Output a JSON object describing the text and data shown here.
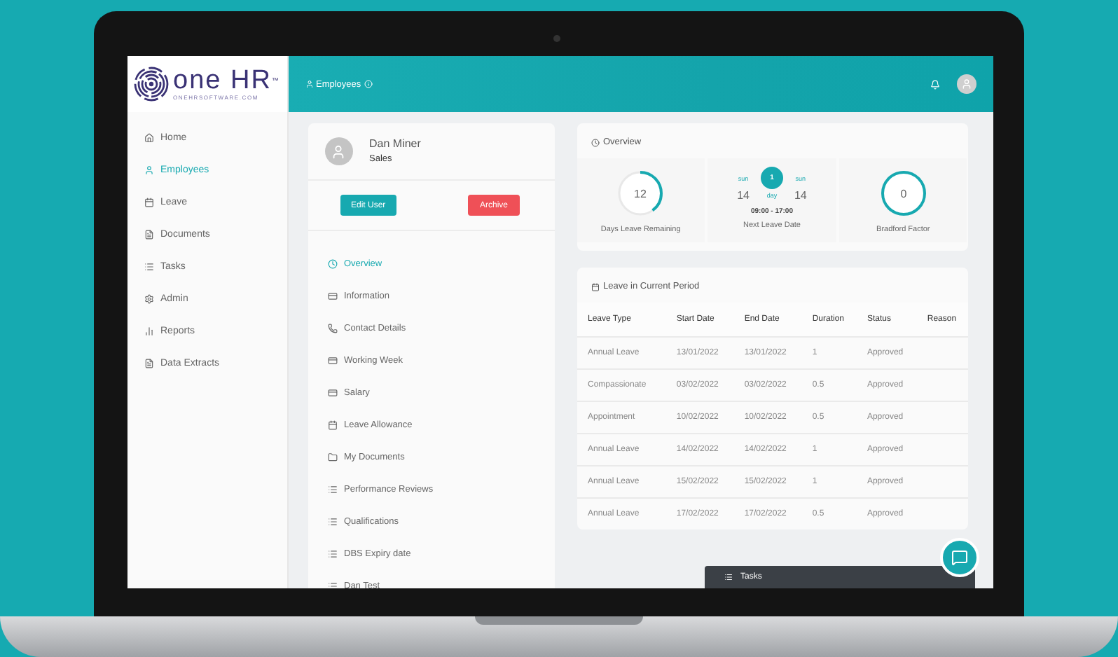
{
  "logo": {
    "name": "one HR",
    "trademark": "™",
    "tagline": "ONEHRSOFTWARE.COM"
  },
  "sidebar": {
    "items": [
      {
        "label": "Home",
        "kind": "home",
        "selected": false
      },
      {
        "label": "Employees",
        "kind": "user",
        "selected": true
      },
      {
        "label": "Leave",
        "kind": "calendar",
        "selected": false
      },
      {
        "label": "Documents",
        "kind": "file",
        "selected": false
      },
      {
        "label": "Tasks",
        "kind": "list",
        "selected": false
      },
      {
        "label": "Admin",
        "kind": "gear",
        "selected": false
      },
      {
        "label": "Reports",
        "kind": "chart",
        "selected": false
      },
      {
        "label": "Data Extracts",
        "kind": "file",
        "selected": false
      }
    ]
  },
  "header": {
    "breadcrumb": "Employees"
  },
  "employee": {
    "name": "Dan Miner",
    "department": "Sales",
    "buttons": [
      {
        "label": "Edit User",
        "kind": "primary"
      },
      {
        "label": "Archive",
        "kind": "danger"
      }
    ],
    "menu": [
      {
        "label": "Overview",
        "kind": "clock",
        "selected": true
      },
      {
        "label": "Information",
        "kind": "card",
        "selected": false
      },
      {
        "label": "Contact Details",
        "kind": "phone",
        "selected": false
      },
      {
        "label": "Working Week",
        "kind": "card",
        "selected": false
      },
      {
        "label": "Salary",
        "kind": "card",
        "selected": false
      },
      {
        "label": "Leave Allowance",
        "kind": "calendar",
        "selected": false
      },
      {
        "label": "My Documents",
        "kind": "folder",
        "selected": false
      },
      {
        "label": "Performance Reviews",
        "kind": "list",
        "selected": false
      },
      {
        "label": "Qualifications",
        "kind": "list",
        "selected": false
      },
      {
        "label": "DBS Expiry date",
        "kind": "list",
        "selected": false
      },
      {
        "label": "Dan Test",
        "kind": "list",
        "selected": false
      }
    ]
  },
  "overview": {
    "title": "Overview",
    "days_remaining": {
      "value": "12",
      "label": "Days Leave Remaining",
      "kind": "arc"
    },
    "next_leave": {
      "from_day": "sun",
      "from_date": "14",
      "count": "1",
      "unit": "day",
      "to_day": "sun",
      "to_date": "14",
      "time": "09:00 - 17:00",
      "label": "Next Leave Date"
    },
    "bradford": {
      "value": "0",
      "label": "Bradford Factor",
      "kind": "circle"
    }
  },
  "leave_table": {
    "title": "Leave in Current Period",
    "columns": [
      "Leave Type",
      "Start Date",
      "End Date",
      "Duration",
      "Status",
      "Reason"
    ],
    "rows": [
      [
        "Annual Leave",
        "13/01/2022",
        "13/01/2022",
        "1",
        "Approved"
      ],
      [
        "Compassionate",
        "03/02/2022",
        "03/02/2022",
        "0.5",
        "Approved"
      ],
      [
        "Appointment",
        "10/02/2022",
        "10/02/2022",
        "0.5",
        "Approved"
      ],
      [
        "Annual Leave",
        "14/02/2022",
        "14/02/2022",
        "1",
        "Approved"
      ],
      [
        "Annual Leave",
        "15/02/2022",
        "15/02/2022",
        "1",
        "Approved"
      ],
      [
        "Annual Leave",
        "17/02/2022",
        "17/02/2022",
        "0.5",
        "Approved"
      ]
    ]
  },
  "tasks_panel": {
    "title": "Tasks"
  }
}
